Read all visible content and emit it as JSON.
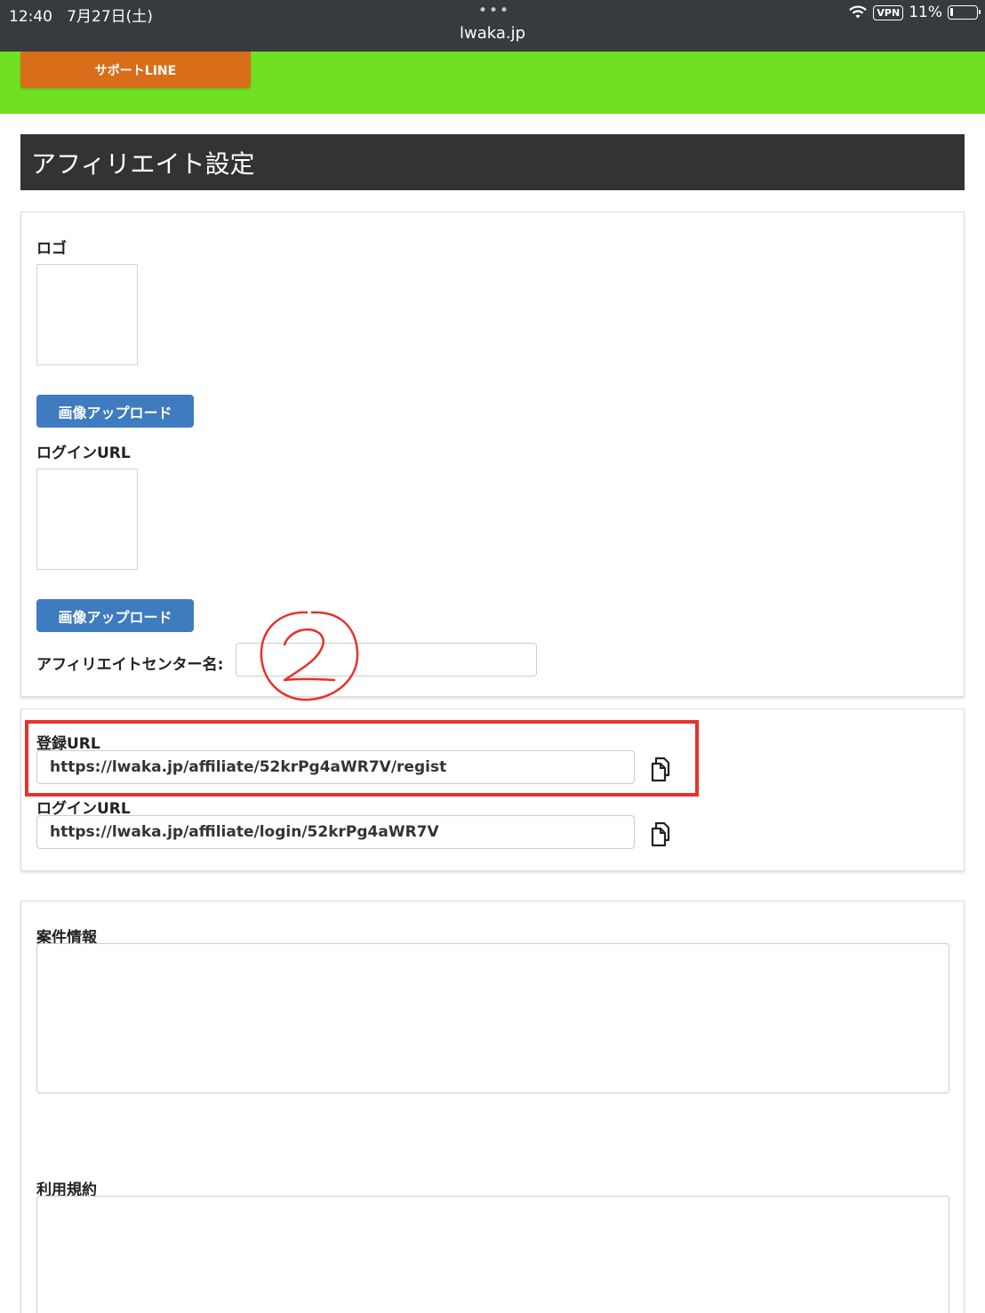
{
  "status_bar": {
    "time": "12:40",
    "date": "7月27日(土)",
    "dots": "•••",
    "url": "lwaka.jp",
    "vpn": "VPN",
    "battery": "11%"
  },
  "header": {
    "support_button": "サポートLINE",
    "accent_color": "#6fe022",
    "button_color": "#d86e19"
  },
  "page_title": "アフィリエイト設定",
  "settings_panel": {
    "logo_label": "ロゴ",
    "upload_button_1": "画像アップロード",
    "login_url_label": "ログインURL",
    "upload_button_2": "画像アップロード",
    "center_name_label": "アフィリエイトセンター名:",
    "center_name_value": ""
  },
  "url_panel": {
    "register_label": "登録URL",
    "register_url": "https://lwaka.jp/affiliate/52krPg4aWR7V/regist",
    "login_label": "ログインURL",
    "login_url": "https://lwaka.jp/affiliate/login/52krPg4aWR7V"
  },
  "info_panel": {
    "case_info_label": "案件情報",
    "terms_label": "利用規約"
  },
  "annotations": {
    "highlight_color": "#e5322d",
    "circle_mark": "②"
  }
}
